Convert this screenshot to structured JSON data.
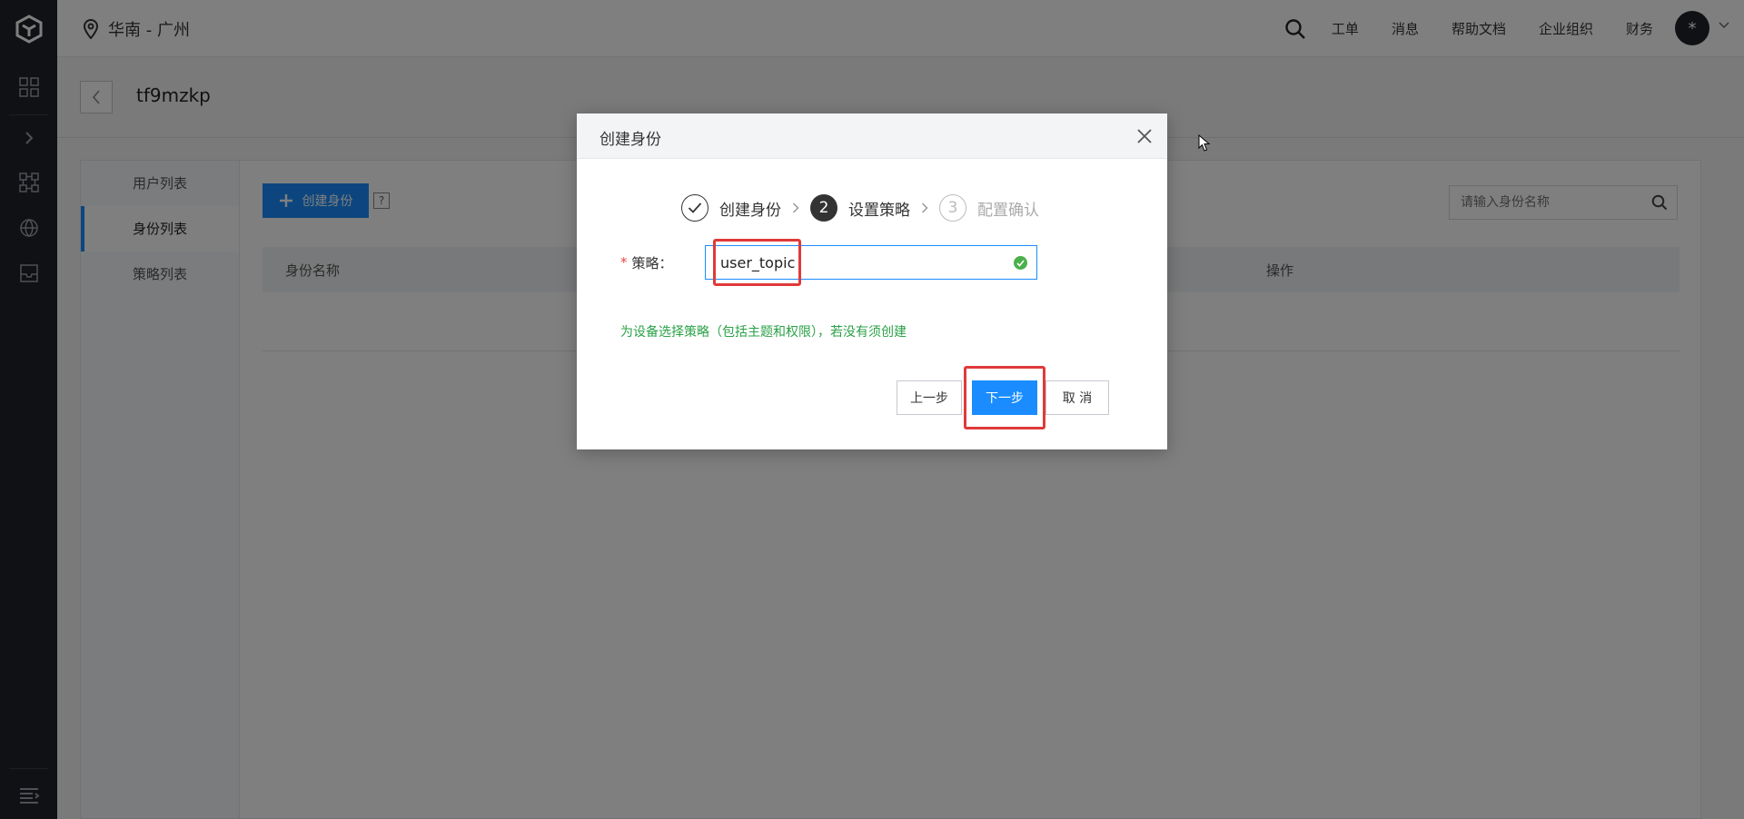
{
  "topbar": {
    "region": "华南 - 广州",
    "nav": [
      "工单",
      "消息",
      "帮助文档",
      "企业组织",
      "财务"
    ],
    "avatar_text": "*"
  },
  "page": {
    "title": "tf9mzkp"
  },
  "subnav": {
    "items": [
      "用户列表",
      "身份列表",
      "策略列表"
    ],
    "active_index": 1
  },
  "toolbar": {
    "create_label": "创建身份",
    "help": "?"
  },
  "search": {
    "placeholder": "请输入身份名称"
  },
  "table": {
    "columns": [
      "身份名称",
      "操作"
    ]
  },
  "modal": {
    "title": "创建身份",
    "steps": [
      {
        "num": "1",
        "label": "创建身份",
        "state": "done"
      },
      {
        "num": "2",
        "label": "设置策略",
        "state": "current"
      },
      {
        "num": "3",
        "label": "配置确认",
        "state": "todo"
      }
    ],
    "field_label": "策略：",
    "required_mark": "*",
    "policy_value": "user_topic",
    "hint": "为设备选择策略（包括主题和权限），若没有须创建",
    "buttons": {
      "prev": "上一步",
      "next": "下一步",
      "cancel": "取 消"
    }
  },
  "colors": {
    "primary": "#1a8cff",
    "success": "#4ab04a",
    "hint": "#2aa147",
    "highlight": "#e03a3a",
    "rail": "#1f2329"
  }
}
